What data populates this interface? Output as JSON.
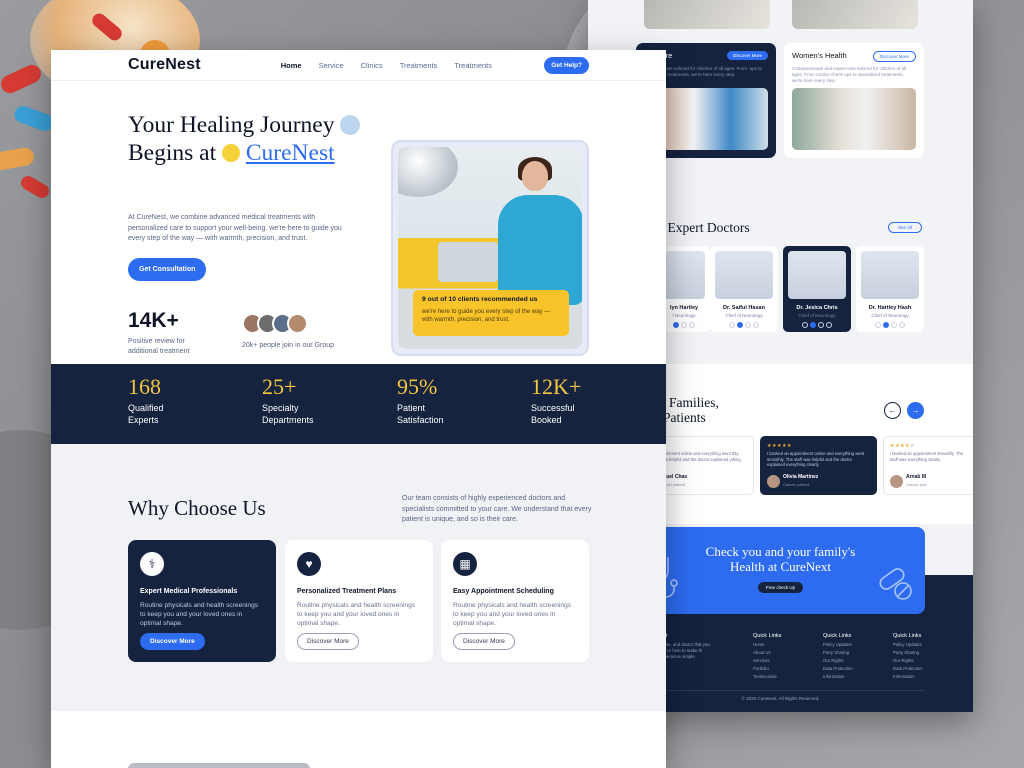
{
  "colors": {
    "accent": "#2d6cf0",
    "navy": "#15233f",
    "gold": "#f4c542"
  },
  "nav": {
    "logo": "CureNest",
    "links": [
      "Home",
      "Service",
      "Clinics",
      "Treatments",
      "Treatments"
    ],
    "help": "Get Help?"
  },
  "hero": {
    "line1": "Your Healing Journey",
    "line2_pre": "Begins at",
    "brand": "CureNest",
    "desc": "At CureNest, we combine advanced medical treatments with personalized care to support your well-being. we're here to guide you every step of the way — with warmth, precision, and trust.",
    "cta": "Get Consultation",
    "stat": "14K+",
    "stat_sub": "Positive review for additional treatment",
    "avatars_text": "20k+ people join in our Group",
    "overlay_title": "9 out of 10 clients recommended us",
    "overlay_text": "we're here to guide you every step of the way — with warmth, precision, and trust."
  },
  "stats": [
    {
      "num": "168",
      "l1": "Qualified",
      "l2": "Experts"
    },
    {
      "num": "25+",
      "l1": "Specialty",
      "l2": "Departments"
    },
    {
      "num": "95%",
      "l1": "Patient",
      "l2": "Satisfaction"
    },
    {
      "num": "12K+",
      "l1": "Successful",
      "l2": "Booked"
    }
  ],
  "why": {
    "title": "Why Choose Us",
    "desc": "Our team consists of highly experienced doctors and specialists committed to your care. We understand that every patient is unique, and so is their care.",
    "cards": [
      {
        "title": "Expert Medical Professionals",
        "desc": "Routine physicals and health screenings to keep you and your loved ones in optimal shape.",
        "btn": "Discover More",
        "icon": "doctor-icon"
      },
      {
        "title": "Personalized Treatment Plans",
        "desc": "Routine physicals and health screenings to keep you and your loved ones in optimal shape.",
        "btn": "Discover More",
        "icon": "heart-shield-icon"
      },
      {
        "title": "Easy Appointment Scheduling",
        "desc": "Routine physicals and health screenings to keep you and your loved ones in optimal shape.",
        "btn": "Discover More",
        "icon": "calendar-icon"
      }
    ]
  },
  "back": {
    "svc": [
      {
        "title": "tric Care",
        "desc": "nd expert care tailored for children of all ages. From -ups to specialized treatments, we're here every step.",
        "btn": "Discover More"
      },
      {
        "title": "Women's Health",
        "desc": "Compassionate and expert care tailored for children of all ages. From routine check-ups to specialized treatments, we're here every step.",
        "btn": "Discover More"
      }
    ],
    "docs_title": "t Our Expert Doctors",
    "see_all": "See All",
    "docs": [
      {
        "name": "lyn Hartley",
        "role": "f Neurology"
      },
      {
        "name": "Dr. Saiful Hasan",
        "role": "Chief of Neurology"
      },
      {
        "name": "Dr. Jesica Chris",
        "role": "Chief of Neurology"
      },
      {
        "name": "Dr. Hartley Hash",
        "role": "Chief of Neurology"
      }
    ],
    "testi_l1": "ed by Families,",
    "testi_l2": "d by Patients",
    "testimonials": [
      {
        "text": "ook an appointment online and everything went thly. The staff was helpful and the doctor explained ything clearly.",
        "name": "amuel Chas",
        "role": "Cancer patient"
      },
      {
        "text": "I booked an appointment online and everything went smoothly. The staff was helpful and the doctor explained everything clearly.",
        "name": "Olivia Martinez",
        "role": "Cancer patient"
      },
      {
        "text": "I booked an appointment smoothly. The staff was everything clearly.",
        "name": "Arnab M",
        "role": "Cancer pati"
      }
    ],
    "cta_l1": "Check you and your family's",
    "cta_l2": "Health at CureNext",
    "cta_btn": "Free check Up",
    "brand_frag": "est",
    "brand_desc": ", time, and doctor that you. We're here to make th experience simple",
    "cols": [
      {
        "h": "Quick Links",
        "items": [
          "Home",
          "About Us",
          "Services",
          "Portfolio",
          "Testimonials"
        ]
      },
      {
        "h": "Quick Links",
        "items": [
          "Policy Updates",
          "Party Sharing",
          "Our Rights",
          "Data Protection",
          "Information"
        ]
      },
      {
        "h": "Quick Links",
        "items": [
          "Policy Updates",
          "Party Sharing",
          "Our Rights",
          "Data Protection",
          "Information"
        ]
      }
    ],
    "copyright": "© 2025 CureNest. All Rights Reserved."
  }
}
